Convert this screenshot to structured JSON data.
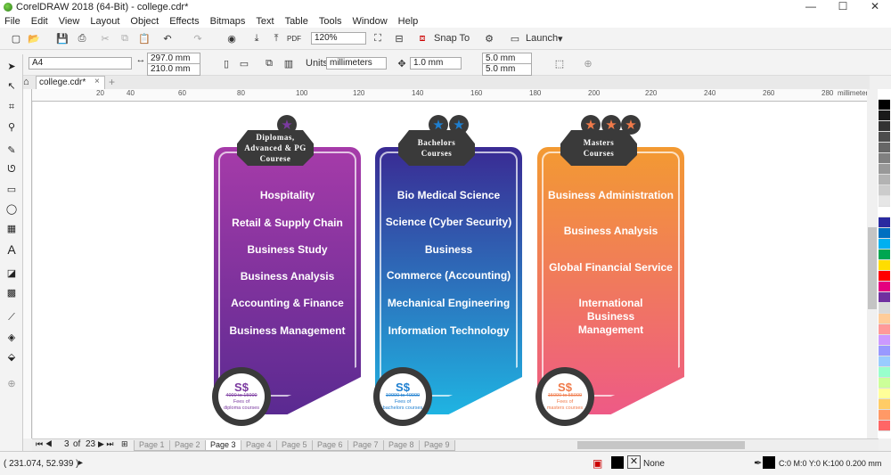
{
  "window": {
    "title": "CorelDRAW 2018 (64-Bit) - college.cdr*",
    "minimize": "—",
    "maximize": "☐",
    "close": "✕"
  },
  "menu": [
    "File",
    "Edit",
    "View",
    "Layout",
    "Object",
    "Effects",
    "Bitmaps",
    "Text",
    "Table",
    "Tools",
    "Window",
    "Help"
  ],
  "toolbar": {
    "zoom": "120%",
    "snap_to": "Snap To",
    "launch": "Launch"
  },
  "propbar": {
    "page_size": "A4",
    "width": "297.0 mm",
    "height": "210.0 mm",
    "units_label": "Units:",
    "units": "millimeters",
    "nudge": "1.0 mm",
    "dup_x": "5.0 mm",
    "dup_y": "5.0 mm"
  },
  "doc_tab": "college.cdr*",
  "ruler": {
    "ticks": [
      "20",
      "40",
      "60",
      "80",
      "100",
      "120",
      "140",
      "160",
      "180",
      "200",
      "220",
      "240",
      "260",
      "280"
    ],
    "unit": "millimeters"
  },
  "cards": [
    {
      "header": [
        "Diplomas,",
        "Advanced & PG",
        "Courese"
      ],
      "stars": 1,
      "items": [
        "Hospitality",
        "Retail & Supply Chain",
        "Business Study",
        "Business Analysis",
        "Accounting & Finance",
        "Business Management"
      ],
      "badge": {
        "symbol": "S$",
        "range": "4000 to 15000",
        "fees": "Fees of",
        "sub": "diploma courses"
      },
      "color_top": "#a63ba9",
      "color_bottom": "#5a2a91",
      "accent": "#7b3aa0"
    },
    {
      "header": [
        "Bachelors",
        "Courses"
      ],
      "stars": 2,
      "items": [
        "Bio Medical Science",
        "Science (Cyber Security)",
        "Business",
        "Commerce (Accounting)",
        "Mechanical Engineering",
        "Information Technology"
      ],
      "badge": {
        "symbol": "S$",
        "range": "10000 to 40000",
        "fees": "Fees of",
        "sub": "bachelors courses"
      },
      "color_top": "#3a2a93",
      "color_bottom": "#1fb4e2",
      "accent": "#1e7fd0"
    },
    {
      "header": [
        "Masters",
        "Courses"
      ],
      "stars": 3,
      "items": [
        "Business Administration",
        "Business Analysis",
        "Global Financial Service",
        "International Business Management"
      ],
      "badge": {
        "symbol": "S$",
        "range": "15000 to 55000",
        "fees": "Fees of",
        "sub": "masters courses"
      },
      "color_top": "#f39a32",
      "color_bottom": "#ee5a86",
      "accent": "#f07a4a"
    }
  ],
  "pages": {
    "current": "3",
    "of": "of",
    "total": "23",
    "tabs": [
      "Page 1",
      "Page 2",
      "Page 3",
      "Page 4",
      "Page 5",
      "Page 6",
      "Page 7",
      "Page 8",
      "Page 9"
    ],
    "active": "Page 3"
  },
  "status": {
    "coords": "( 231.074, 52.939 )",
    "arrow": "▸",
    "fill": "None",
    "outline": "C:0 M:0 Y:0 K:100  0.200 mm"
  },
  "palette": [
    "#ffffff",
    "#000000",
    "#1a1a1a",
    "#333333",
    "#4d4d4d",
    "#666666",
    "#808080",
    "#999999",
    "#b3b3b3",
    "#cccccc",
    "#e6e6e6",
    "#ffffff",
    "#2a2aa0",
    "#0070c0",
    "#00b0f0",
    "#00a651",
    "#ffdd00",
    "#ff0000",
    "#e4007f",
    "#7030a0",
    "#d9d9d9",
    "#ffcc99",
    "#ff9999",
    "#cc99ff",
    "#9999ff",
    "#99ccff",
    "#99ffcc",
    "#ccff99",
    "#ffff99",
    "#ffcc66",
    "#ff9966",
    "#ff6666"
  ]
}
